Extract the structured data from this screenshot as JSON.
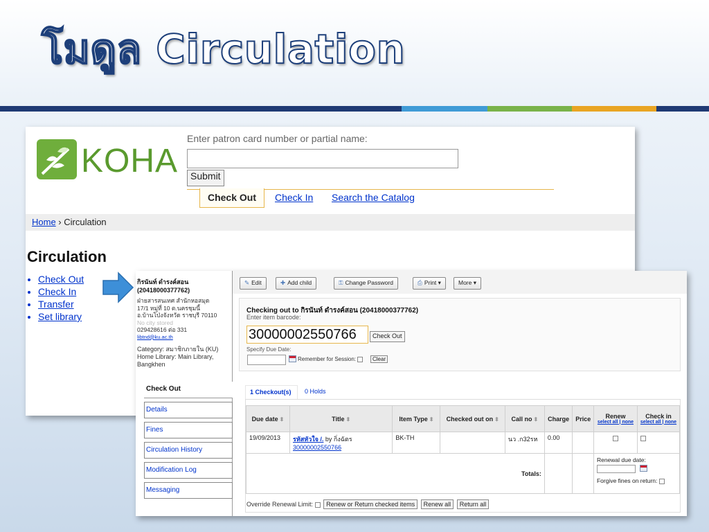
{
  "slide": {
    "title": "โมดูล Circulation"
  },
  "koha": {
    "logo_text": "KOHA",
    "patron_label": "Enter patron card number or partial name:",
    "patron_value": "",
    "submit_label": "Submit",
    "tabs": [
      "Check Out",
      "Check In",
      "Search the Catalog"
    ],
    "breadcrumb": {
      "home": "Home",
      "sep": " › ",
      "current": "Circulation"
    },
    "heading": "Circulation",
    "menu": [
      "Check Out",
      "Check In",
      "Transfer",
      "Set library"
    ]
  },
  "checkout": {
    "patron": {
      "name": "กิรนันท์ ดำรงค์สอน (20418000377762)",
      "addr1": "ฝ่ายสารสนเทศ สำนักหอสมุด",
      "addr2": "17/1 หมู่ที่ 10 ต.นครชุมนี้",
      "addr3": "อ.บ้านโป่งจังหวัด ราชบุรี 70110",
      "no_city": "No city stored",
      "phone": "029428616 ต่อ 331",
      "email": "libtnd@ku.ac.th",
      "category": "Category: สมาชิกภายใน (KU)",
      "home_library": "Home Library: Main Library, Bangkhen"
    },
    "patron_menu": [
      "Check Out",
      "Details",
      "Fines",
      "Circulation History",
      "Modification Log",
      "Messaging"
    ],
    "toolbar": [
      "Edit",
      "Add child",
      "Change Password",
      "Print ▾",
      "More ▾"
    ],
    "checking_out_title": "Checking out to กิรนันท์ ดำรงค์สอน (20418000377762)",
    "barcode_label": "Enter item barcode:",
    "barcode_value": "30000002550766",
    "checkout_btn": "Check Out",
    "due_label": "Specify Due Date:",
    "remember_label": "Remember for Session:",
    "clear_btn": "Clear",
    "tab_checkouts": "1 Checkout(s)",
    "tab_holds": "0 Holds",
    "table": {
      "headers": [
        "Due date",
        "Title",
        "Item Type",
        "Checked out on",
        "Call no",
        "Charge",
        "Price",
        "Renew",
        "Check in"
      ],
      "renew_links": "select all | none",
      "checkin_links": "select all | none",
      "row": {
        "due": "19/09/2013",
        "title": "รหัสหัวใจ /.",
        "author": " by กิ่งฉัตร",
        "barcode": "30000002550766",
        "itype": "BK-TH",
        "checked_out": "",
        "call_no": "นว .ก32รห",
        "charge": "0.00",
        "price": ""
      },
      "totals_label": "Totals:",
      "renewal_due": "Renewal due date:",
      "forgive": "Forgive fines on return:"
    },
    "override_label": "Override Renewal Limit:",
    "btn_renew_return": "Renew or Return checked items",
    "btn_renew_all": "Renew all",
    "btn_return_all": "Return all"
  }
}
